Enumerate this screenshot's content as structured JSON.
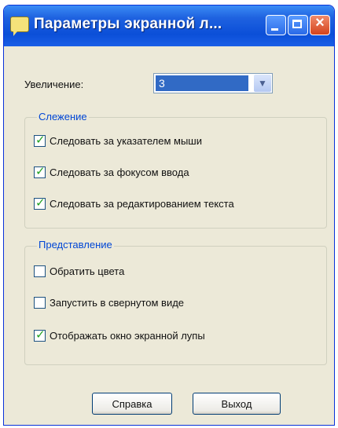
{
  "window": {
    "title": "Параметры экранной л...",
    "controls": {
      "minimize": "minimize-icon",
      "maximize": "maximize-icon",
      "close": "×"
    }
  },
  "zoom": {
    "label": "Увеличение:",
    "value": "3"
  },
  "tracking": {
    "title": "Слежение",
    "options": [
      {
        "label": "Следовать за указателем мыши",
        "checked": true
      },
      {
        "label": "Следовать за фокусом ввода",
        "checked": true
      },
      {
        "label": "Следовать за редактированием текста",
        "checked": true
      }
    ]
  },
  "presentation": {
    "title": "Представление",
    "options": [
      {
        "label": "Обратить цвета",
        "checked": false
      },
      {
        "label": "Запустить в свернутом виде",
        "checked": false
      },
      {
        "label": "Отображать окно экранной лупы",
        "checked": true
      }
    ]
  },
  "buttons": {
    "help": "Справка",
    "exit": "Выход"
  }
}
